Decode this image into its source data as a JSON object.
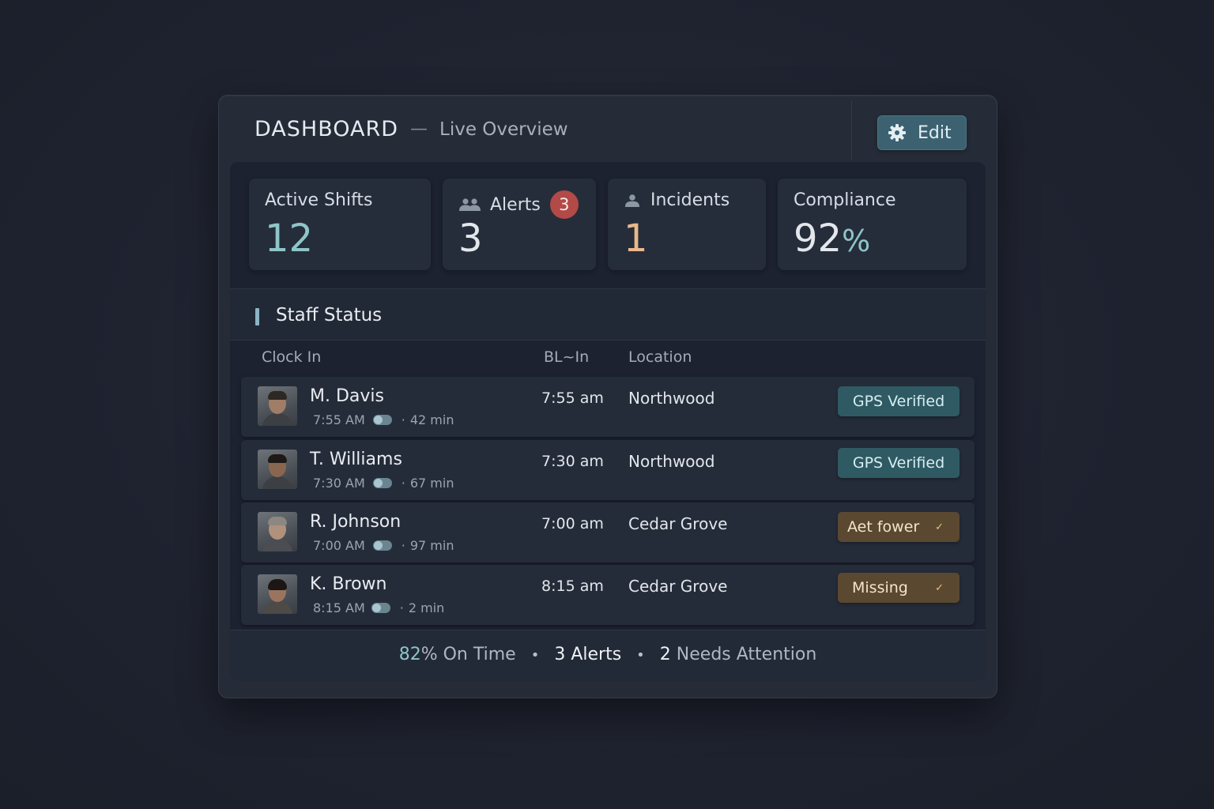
{
  "header": {
    "title": "DASHBOARD",
    "separator": "—",
    "subtitle": "Live Overview",
    "edit_label": "Edit"
  },
  "stats": {
    "active_shifts": {
      "label": "Active Shifts",
      "value": "12"
    },
    "alerts": {
      "label": "Alerts",
      "badge": "3",
      "value": "3"
    },
    "incidents": {
      "label": "Incidents",
      "value": "1"
    },
    "compliance": {
      "label": "Compliance",
      "value": "92",
      "unit": "%"
    }
  },
  "staff": {
    "section_title": "Staff Status",
    "columns": [
      "Clock In",
      "BL~In",
      "Location"
    ],
    "rows": [
      {
        "name": "M. Davis",
        "clock": "7:55 AM",
        "duration": "42 min",
        "time": "7:55 am",
        "location": "Northwood",
        "status": "GPS Verified",
        "status_kind": "ok"
      },
      {
        "name": "T. Williams",
        "clock": "7:30 AM",
        "duration": "67 min",
        "time": "7:30 am",
        "location": "Northwood",
        "status": "GPS Verified",
        "status_kind": "ok"
      },
      {
        "name": "R. Johnson",
        "clock": "7:00 AM",
        "duration": "97 min",
        "time": "7:00 am",
        "location": "Cedar Grove",
        "status": "Aet fower",
        "status_kind": "warn"
      },
      {
        "name": "K. Brown",
        "clock": "8:15 AM",
        "duration": "2 min",
        "time": "8:15 am",
        "location": "Cedar Grove",
        "status": "Missing",
        "status_kind": "warn"
      }
    ]
  },
  "footer": {
    "on_time_value": "82",
    "on_time_label": "% On Time",
    "alerts_value": "3",
    "alerts_label": "Alerts",
    "attention_value": "2",
    "attention_label": "Needs Attention"
  },
  "colors": {
    "accent_teal": "#8ec5c8",
    "alert_badge": "#b24a48",
    "incident_value": "#e8b98a",
    "status_ok": "#2f5a63",
    "status_warn": "#5b4831"
  },
  "icons": {
    "edit": "gear-icon",
    "alerts": "people-icon",
    "incidents": "person-icon",
    "row_toggle": "toggle-icon",
    "status_warn": "check-icon"
  }
}
